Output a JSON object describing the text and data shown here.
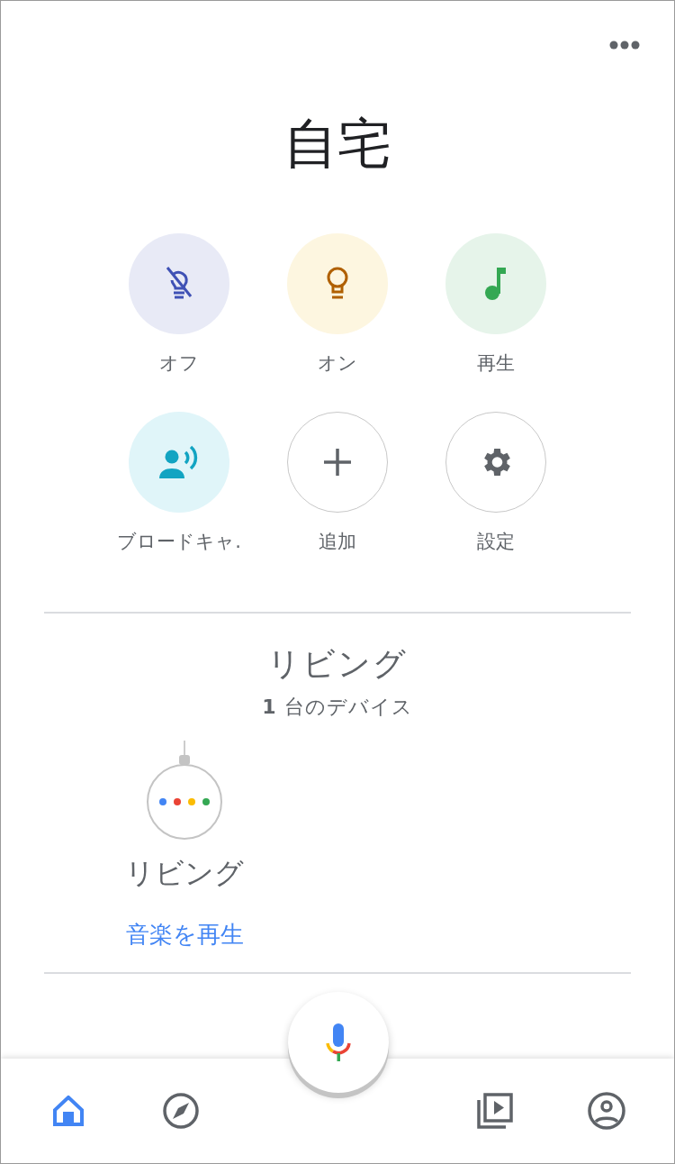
{
  "title": "自宅",
  "actions": [
    {
      "kind": "light-off",
      "label": "オフ"
    },
    {
      "kind": "light-on",
      "label": "オン"
    },
    {
      "kind": "play",
      "label": "再生"
    },
    {
      "kind": "broadcast",
      "label": "ブロードキャ."
    },
    {
      "kind": "add",
      "label": "追加"
    },
    {
      "kind": "settings",
      "label": "設定"
    }
  ],
  "room": {
    "name": "リビング",
    "device_count": "**1** 台のデバイス",
    "devices": [
      {
        "name": "リビング",
        "action": "音楽を再生"
      }
    ]
  },
  "nav": [
    {
      "kind": "home",
      "selected": true
    },
    {
      "kind": "explore",
      "selected": false
    },
    {
      "kind": "media",
      "selected": false
    },
    {
      "kind": "account",
      "selected": false
    }
  ]
}
